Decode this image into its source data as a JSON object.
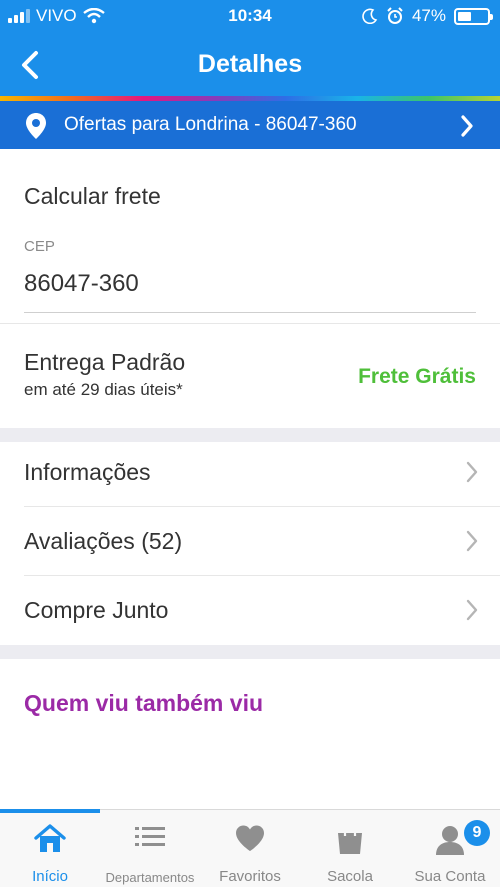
{
  "status_bar": {
    "carrier": "VIVO",
    "time": "10:34",
    "battery": "47%",
    "battery_level": 0.47
  },
  "header": {
    "title": "Detalhes"
  },
  "location": {
    "label": "Ofertas para Londrina - 86047-360"
  },
  "shipping": {
    "title": "Calcular frete",
    "cep_label": "CEP",
    "cep_value": "86047-360",
    "option_name": "Entrega Padrão",
    "option_time": "em até 29 dias úteis*",
    "option_price": "Frete Grátis"
  },
  "menu": [
    {
      "label": "Informações"
    },
    {
      "label": "Avaliações (52)"
    },
    {
      "label": "Compre Junto"
    }
  ],
  "also_viewed": {
    "title": "Quem viu também viu"
  },
  "bottom_nav": {
    "items": [
      {
        "label": "Início",
        "icon": "home-icon"
      },
      {
        "label": "Departamentos",
        "icon": "list-icon"
      },
      {
        "label": "Favoritos",
        "icon": "heart-icon"
      },
      {
        "label": "Sacola",
        "icon": "bag-icon"
      },
      {
        "label": "Sua Conta",
        "icon": "user-icon"
      }
    ],
    "account_badge": "9"
  },
  "colors": {
    "primary": "#1b8fea",
    "location_bar": "#1a6fd6",
    "free_shipping": "#4fbf3a",
    "also_viewed": "#9b2aa6"
  }
}
